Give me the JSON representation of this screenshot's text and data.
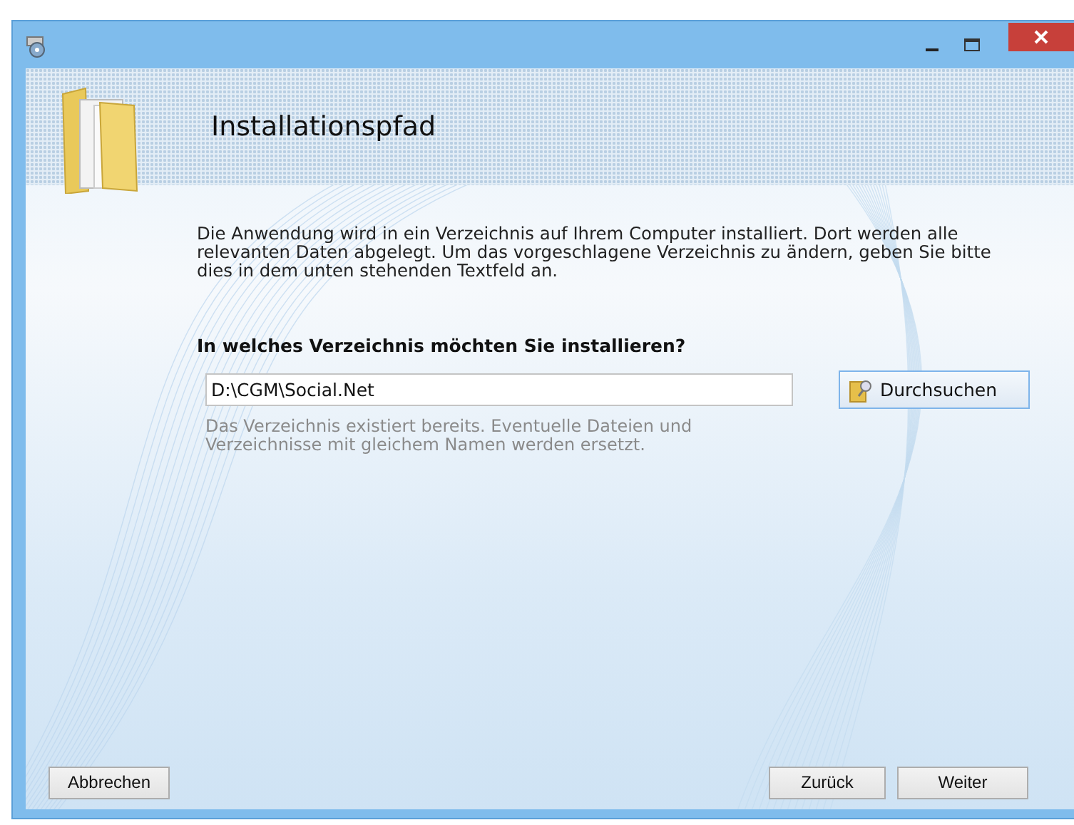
{
  "header": {
    "title": "Installationspfad"
  },
  "description": "Die Anwendung wird in ein Verzeichnis auf Ihrem Computer installiert. Dort werden alle relevanten Daten abgelegt. Um das vorgeschlagene Verzeichnis zu ändern, geben Sie bitte dies in dem unten stehenden Textfeld an.",
  "question": "In welches Verzeichnis möchten Sie installieren?",
  "path_field": {
    "value": "D:\\CGM\\Social.Net"
  },
  "browse_button": "Durchsuchen",
  "hint": "Das Verzeichnis existiert bereits. Eventuelle Dateien und Verzeichnisse mit gleichem Namen werden ersetzt.",
  "buttons": {
    "cancel": "Abbrechen",
    "back": "Zurück",
    "next": "Weiter"
  }
}
